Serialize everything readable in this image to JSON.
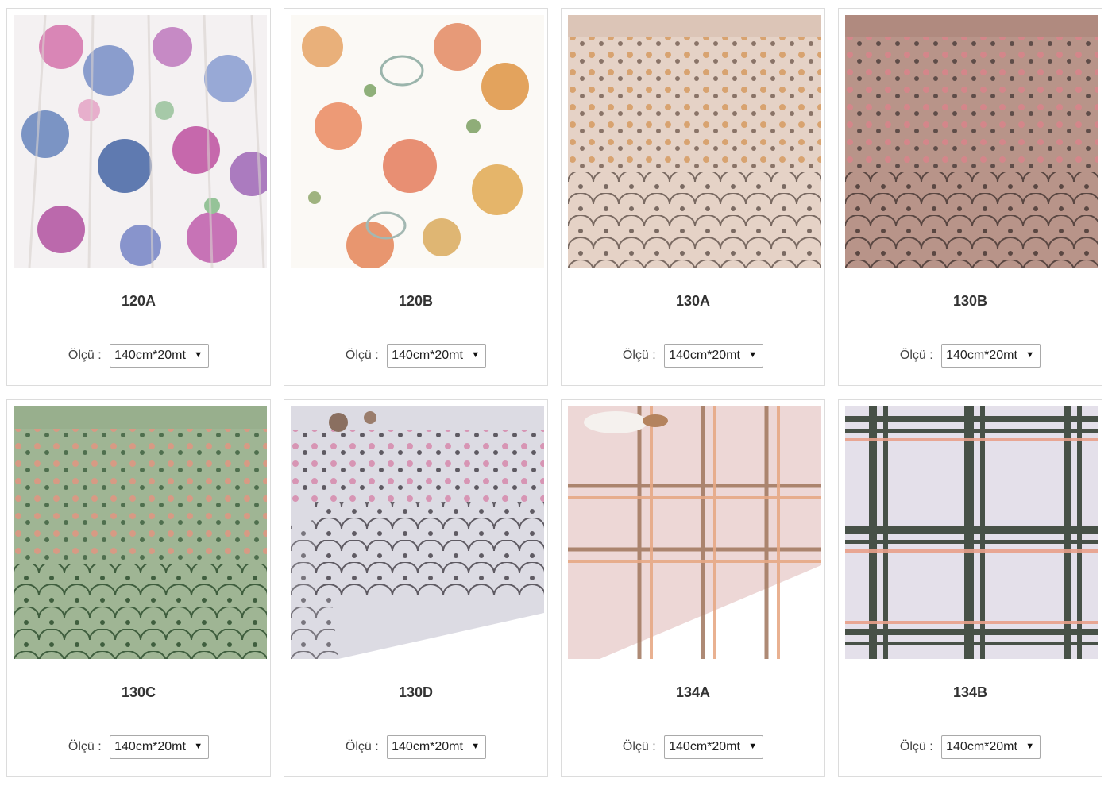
{
  "products": [
    {
      "code": "120A",
      "size_label": "Ölçü :",
      "size_value": "140cm*20mt"
    },
    {
      "code": "120B",
      "size_label": "Ölçü :",
      "size_value": "140cm*20mt"
    },
    {
      "code": "130A",
      "size_label": "Ölçü :",
      "size_value": "140cm*20mt"
    },
    {
      "code": "130B",
      "size_label": "Ölçü :",
      "size_value": "140cm*20mt"
    },
    {
      "code": "130C",
      "size_label": "Ölçü :",
      "size_value": "140cm*20mt"
    },
    {
      "code": "130D",
      "size_label": "Ölçü :",
      "size_value": "140cm*20mt"
    },
    {
      "code": "134A",
      "size_label": "Ölçü :",
      "size_value": "140cm*20mt"
    },
    {
      "code": "134B",
      "size_label": "Ölçü :",
      "size_value": "140cm*20mt"
    }
  ],
  "icons": {
    "dropdown": "caret-down-icon"
  },
  "colors": {
    "card_border": "#dcdcdc",
    "text": "#333333"
  }
}
